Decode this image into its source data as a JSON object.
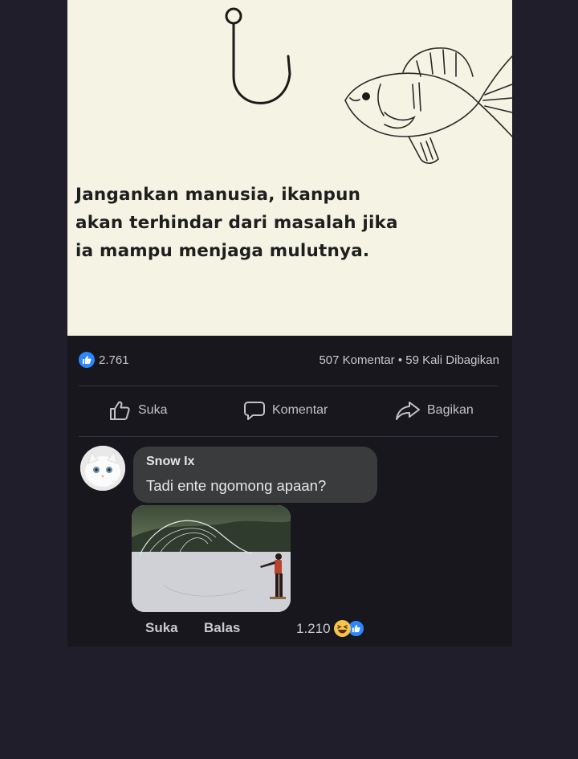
{
  "post": {
    "caption_lines": [
      "Jangankan manusia, ikanpun",
      "akan terhindar dari masalah jika",
      "ia mampu menjaga mulutnya."
    ],
    "like_count": "2.761",
    "share_stats": "507 Komentar • 59 Kali Dibagikan",
    "actions": {
      "like": "Suka",
      "comment": "Komentar",
      "share": "Bagikan"
    }
  },
  "comment": {
    "author": "Snow Ix",
    "text": "Tadi ente ngomong apaan?",
    "like_label": "Suka",
    "reply_label": "Balas",
    "reaction_count": "1.210"
  },
  "colors": {
    "background": "#1f1e2a",
    "post_bg": "#17171d",
    "image_bg": "#f4f3e4",
    "bubble_bg": "#3a3b3c",
    "like_blue": "#2d88ff",
    "haha_yellow": "#f7c44a"
  }
}
